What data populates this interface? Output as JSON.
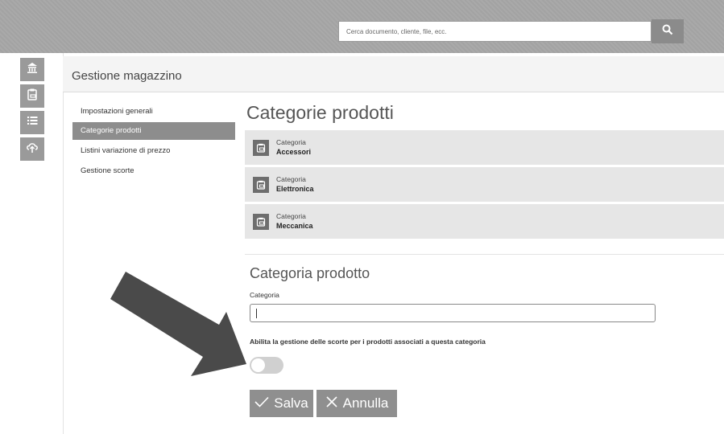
{
  "search": {
    "placeholder": "Cerca documento, cliente, file, ecc."
  },
  "rail": {
    "icons": [
      "home-building-icon",
      "clipboard-icon",
      "list-icon",
      "cloud-upload-icon"
    ]
  },
  "header": {
    "title": "Gestione magazzino"
  },
  "menu": {
    "items": [
      {
        "label": "Impostazioni generali"
      },
      {
        "label": "Categorie prodotti",
        "active": true
      },
      {
        "label": "Listini variazione di prezzo"
      },
      {
        "label": "Gestione scorte"
      }
    ]
  },
  "main": {
    "title": "Categorie prodotti",
    "categories": [
      {
        "label": "Categoria",
        "name": "Accessori"
      },
      {
        "label": "Categoria",
        "name": "Elettronica"
      },
      {
        "label": "Categoria",
        "name": "Meccanica"
      }
    ]
  },
  "form": {
    "title": "Categoria prodotto",
    "field_label": "Categoria",
    "field_value": "",
    "toggle_label": "Abilita la gestione delle scorte per i prodotti associati a questa categoria",
    "toggle_on": false,
    "save_label": "Salva",
    "cancel_label": "Annulla"
  },
  "colors": {
    "button": "#8f8f8f",
    "active_menu": "#8d8d8d",
    "row_bg": "#e6e6e6",
    "arrow": "#4a4a4a"
  }
}
